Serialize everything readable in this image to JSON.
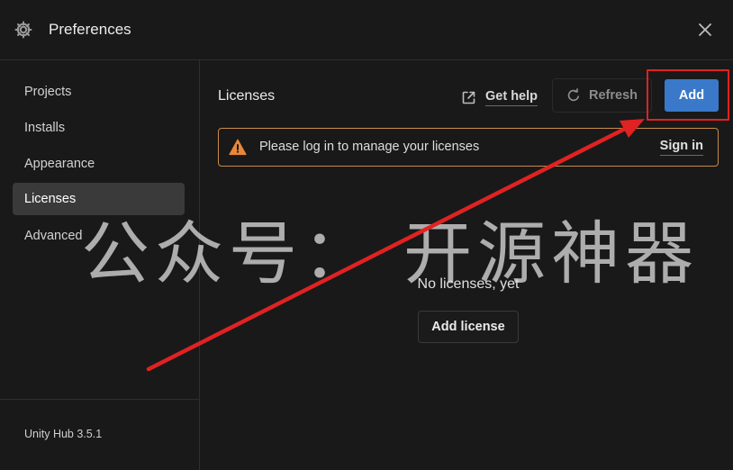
{
  "window": {
    "title": "Preferences",
    "icons": {
      "app": "gear-icon",
      "close": "close-icon"
    }
  },
  "sidebar": {
    "items": [
      {
        "label": "Projects",
        "active": false
      },
      {
        "label": "Installs",
        "active": false
      },
      {
        "label": "Appearance",
        "active": false
      },
      {
        "label": "Licenses",
        "active": true
      },
      {
        "label": "Advanced",
        "active": false
      }
    ],
    "version": "Unity Hub 3.5.1"
  },
  "main": {
    "title": "Licenses",
    "get_help_label": "Get help",
    "get_help_icon": "external-link-icon",
    "refresh_label": "Refresh",
    "refresh_icon": "refresh-icon",
    "add_label": "Add",
    "banner": {
      "icon": "warning-icon",
      "message": "Please log in to manage your licenses",
      "action_label": "Sign in"
    },
    "empty_state": {
      "message": "No licenses, yet",
      "button_label": "Add license"
    }
  },
  "overlay": {
    "watermark": "公众号： 开源神器",
    "annotation": "red-arrow-pointing-to-add-button"
  },
  "colors": {
    "background": "#191919",
    "accent": "#3a79c9",
    "warning": "#e8873a",
    "warning_border": "#c98a4a",
    "annotation_red": "#e02222",
    "active_nav": "#3a3a3a"
  }
}
